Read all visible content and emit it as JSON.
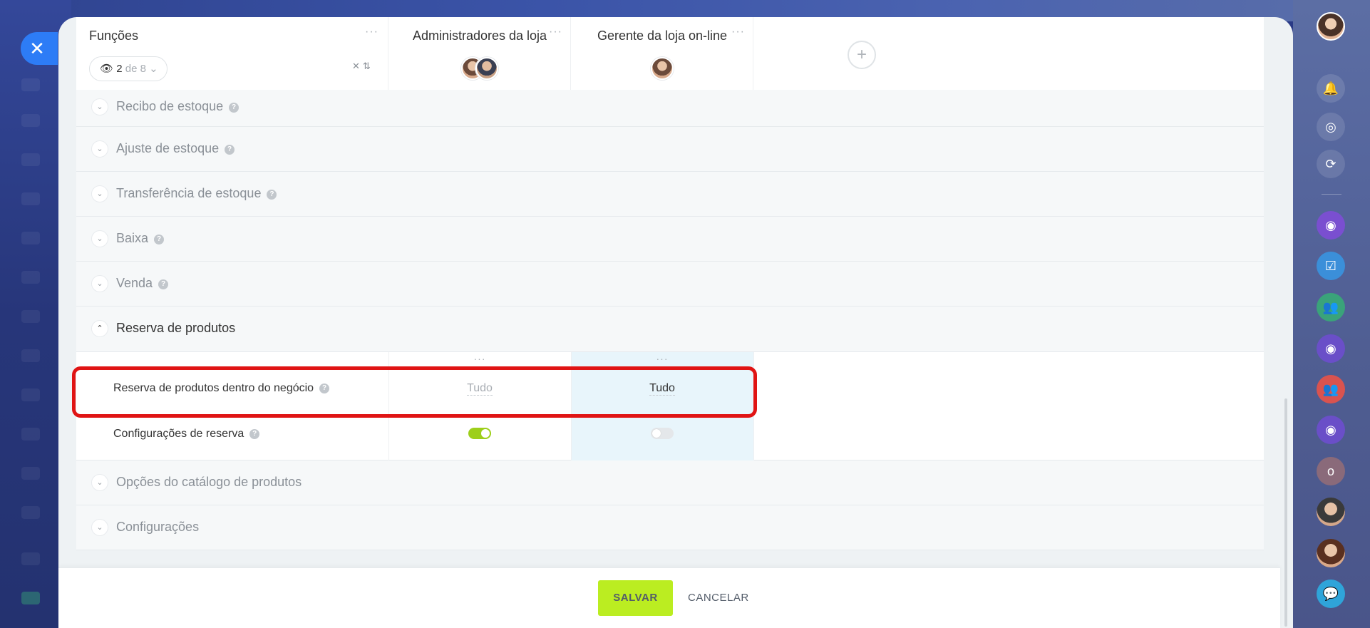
{
  "header": {
    "roles_title": "Funções",
    "pill_count": "2",
    "pill_of": "de 8",
    "columns": [
      {
        "title": "Administradores da loja"
      },
      {
        "title": "Gerente da loja on-line"
      }
    ],
    "add_label": "+",
    "dots": "···",
    "sort_icons": "✕⇅"
  },
  "sections": [
    {
      "label": "Recibo de estoque"
    },
    {
      "label": "Ajuste de estoque"
    },
    {
      "label": "Transferência de estoque"
    },
    {
      "label": "Baixa"
    },
    {
      "label": "Venda"
    },
    {
      "label": "Reserva de produtos"
    },
    {
      "label": "Opções do catálogo de produtos"
    },
    {
      "label": "Configurações"
    }
  ],
  "subrows": {
    "row1": {
      "label": "Reserva de produtos dentro do negócio",
      "col1": "Tudo",
      "col2": "Tudo"
    },
    "row2": {
      "label": "Configurações de reserva",
      "col1_on": true,
      "col2_on": false
    }
  },
  "help_glyph": "?",
  "footer": {
    "save_label": "SALVAR",
    "cancel_label": "CANCELAR"
  },
  "colors": {
    "save_bg": "#bbed21",
    "toggle_on": "#9dcf1a",
    "highlight_col": "#e8f5fb",
    "close_btn": "#2d7cf6",
    "annotation": "#e01414"
  }
}
